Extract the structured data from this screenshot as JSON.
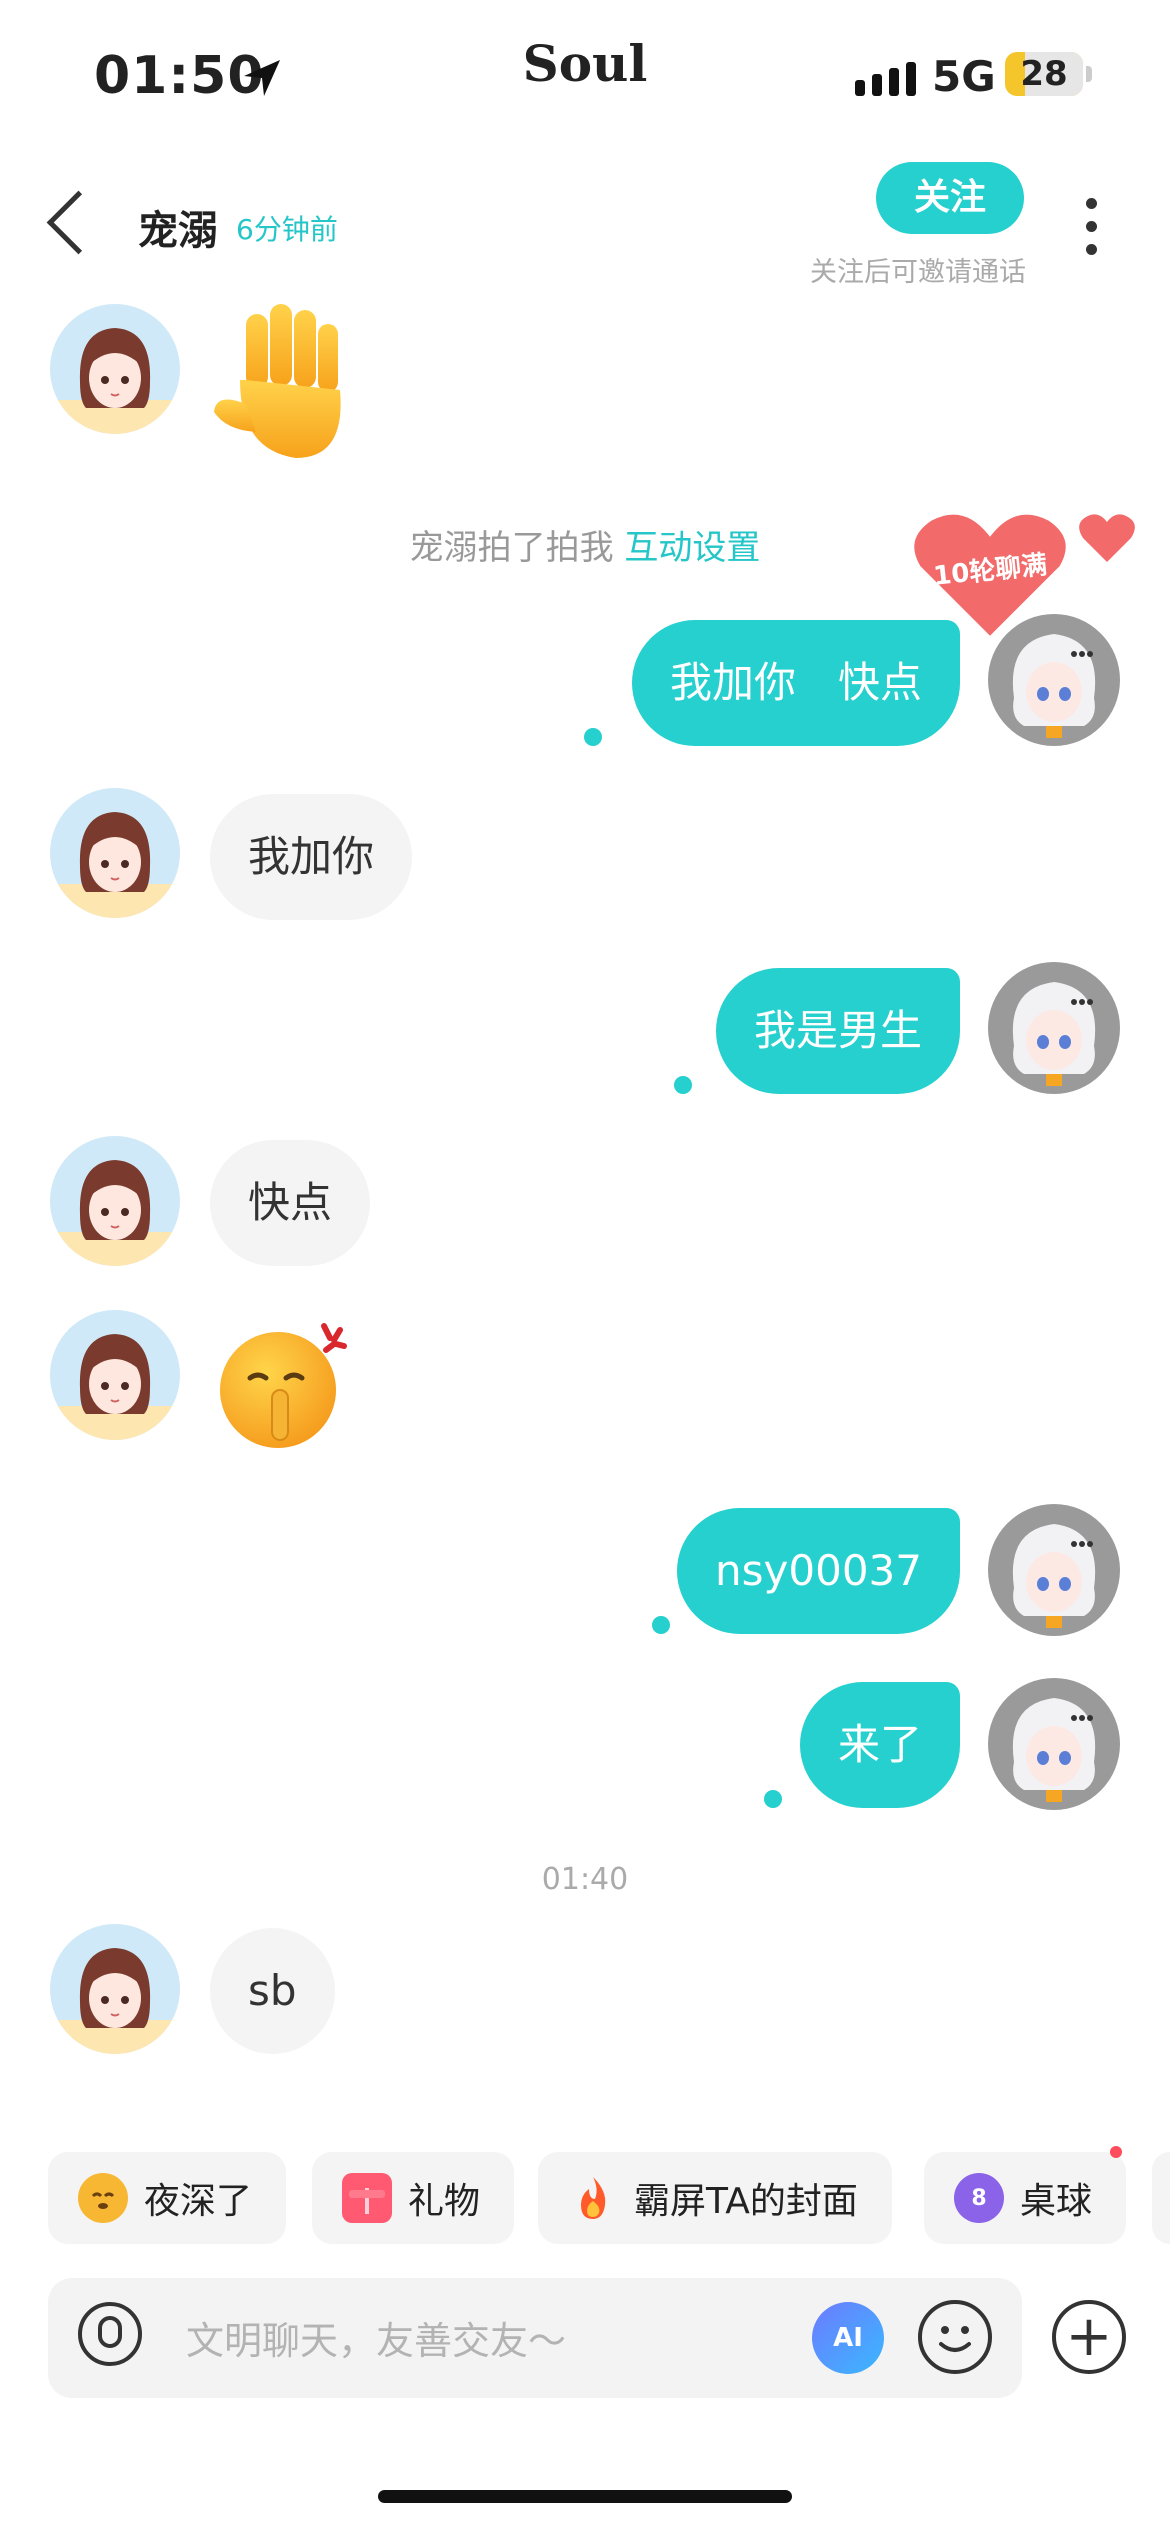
{
  "status_bar": {
    "time": "01:50",
    "app_name": "Soul",
    "network": "5G",
    "battery": "28"
  },
  "header": {
    "contact_name": "宠溺",
    "last_seen": "6分钟前",
    "follow_label": "关注",
    "follow_hint": "关注后可邀请通话"
  },
  "system_note": {
    "text": "宠溺拍了拍我 ",
    "link": "互动设置"
  },
  "badge": {
    "label": "10轮聊满"
  },
  "messages": [
    {
      "side": "in",
      "type": "emoji",
      "icon": "raised-hand-icon"
    },
    {
      "side": "out",
      "text": "我加你　快点"
    },
    {
      "side": "in",
      "text": "我加你"
    },
    {
      "side": "out",
      "text": "我是男生"
    },
    {
      "side": "in",
      "text": "快点"
    },
    {
      "side": "in",
      "type": "emoji",
      "icon": "shushing-face-icon"
    },
    {
      "side": "out",
      "text": "nsy00037"
    },
    {
      "side": "out",
      "text": "来了"
    },
    {
      "side": "in",
      "text": "sb"
    }
  ],
  "timestamp": "01:40",
  "quick_actions": [
    {
      "label": "夜深了",
      "icon": "sleepy-face-icon"
    },
    {
      "label": "礼物",
      "icon": "gift-icon"
    },
    {
      "label": "霸屏TA的封面",
      "icon": "fire-icon"
    },
    {
      "label": "桌球",
      "icon": "billiard-ball-icon",
      "icon_text": "8"
    }
  ],
  "composer": {
    "placeholder": "文明聊天，友善交友～",
    "ai_label": "AI"
  },
  "colors": {
    "accent": "#25d0ce",
    "incoming_bubble": "#f4f4f4",
    "badge_heart": "#f26a6a"
  }
}
